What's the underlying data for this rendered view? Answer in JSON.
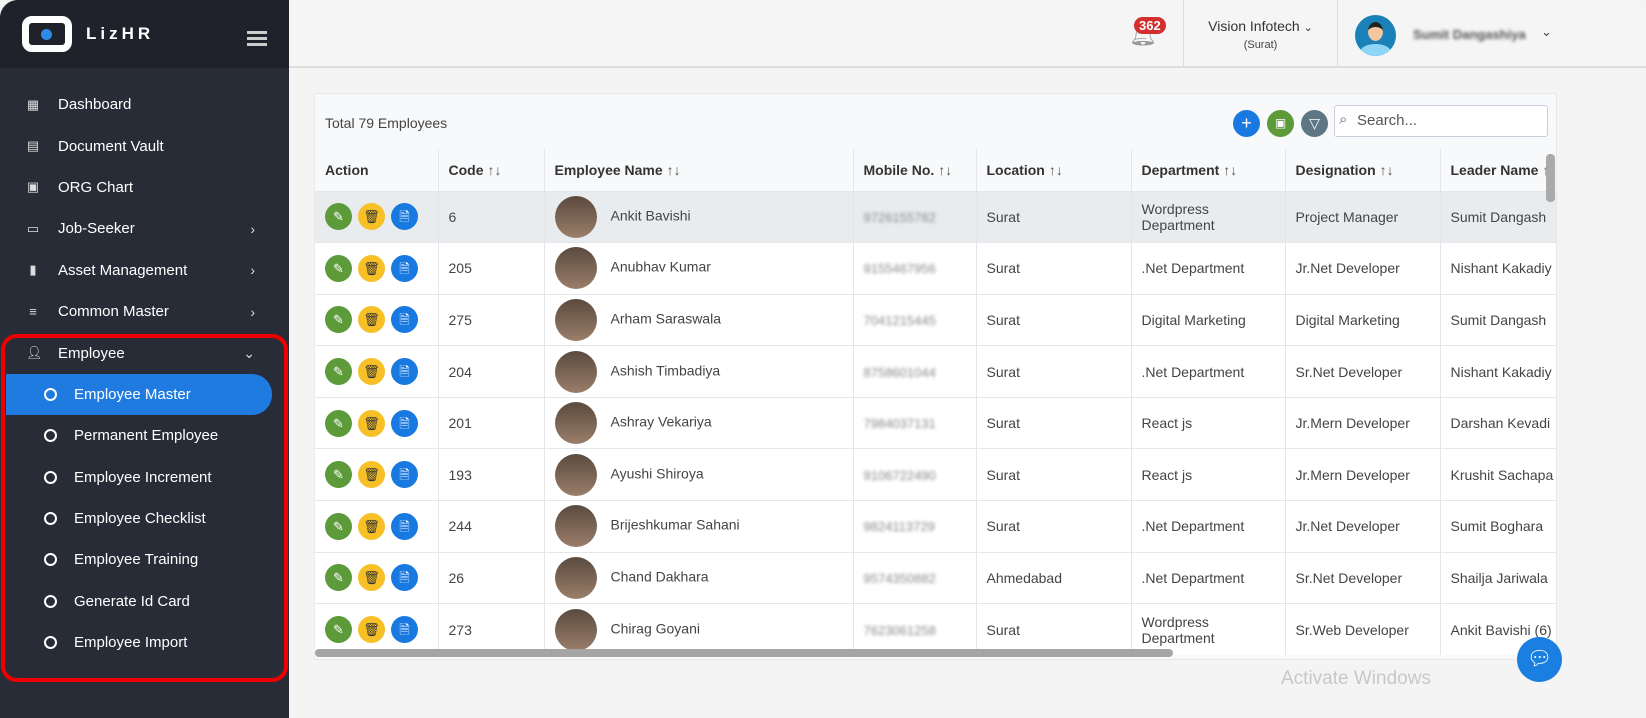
{
  "app": {
    "name": "LizHR"
  },
  "sidebar": {
    "items": [
      {
        "label": "Dashboard",
        "icon": "dashboard-icon"
      },
      {
        "label": "Document Vault",
        "icon": "document-icon"
      },
      {
        "label": "ORG Chart",
        "icon": "image-icon"
      },
      {
        "label": "Job-Seeker",
        "icon": "monitor-icon",
        "has_children": true
      },
      {
        "label": "Asset Management",
        "icon": "book-icon",
        "has_children": true
      },
      {
        "label": "Common Master",
        "icon": "list-icon",
        "has_children": true
      },
      {
        "label": "Employee",
        "icon": "user-icon",
        "expanded": true
      }
    ],
    "employee_sub": [
      {
        "label": "Employee Master",
        "active": true
      },
      {
        "label": "Permanent Employee"
      },
      {
        "label": "Employee Increment"
      },
      {
        "label": "Employee Checklist"
      },
      {
        "label": "Employee Training"
      },
      {
        "label": "Generate Id Card"
      },
      {
        "label": "Employee Import"
      }
    ]
  },
  "header": {
    "notification_count": "362",
    "company": "Vision Infotech",
    "branch": "(Surat)",
    "user": "Sumit Dangashiya"
  },
  "table": {
    "total": "Total 79 Employees",
    "search_placeholder": "Search...",
    "columns": [
      "Action",
      "Code",
      "Employee Name",
      "Mobile No.",
      "Location",
      "Department",
      "Designation",
      "Leader Name"
    ],
    "rows": [
      [
        "6",
        "Ankit Bavishi",
        "9726155782",
        "Surat",
        "Wordpress Department",
        "Project Manager",
        "Sumit Dangash"
      ],
      [
        "205",
        "Anubhav Kumar",
        "9155467956",
        "Surat",
        ".Net Department",
        "Jr.Net Developer",
        "Nishant Kakadiy"
      ],
      [
        "275",
        "Arham Saraswala",
        "7041215445",
        "Surat",
        "Digital Marketing",
        "Digital Marketing",
        "Sumit Dangash"
      ],
      [
        "204",
        "Ashish Timbadiya",
        "8758601044",
        "Surat",
        ".Net Department",
        "Sr.Net Developer",
        "Nishant Kakadiy"
      ],
      [
        "201",
        "Ashray Vekariya",
        "7984037131",
        "Surat",
        "React js",
        "Jr.Mern Developer",
        "Darshan Kevadi"
      ],
      [
        "193",
        "Ayushi Shiroya",
        "9106722490",
        "Surat",
        "React js",
        "Jr.Mern Developer",
        "Krushit Sachapa"
      ],
      [
        "244",
        "Brijeshkumar Sahani",
        "9824113729",
        "Surat",
        ".Net Department",
        "Jr.Net Developer",
        "Sumit Boghara"
      ],
      [
        "26",
        "Chand Dakhara",
        "9574350882",
        "Ahmedabad",
        ".Net Department",
        "Sr.Net Developer",
        "Shailja Jariwala"
      ],
      [
        "273",
        "Chirag Goyani",
        "7623061258",
        "Surat",
        "Wordpress Department",
        "Sr.Web Developer",
        "Ankit Bavishi (6)"
      ]
    ]
  },
  "watermark": "Activate Windows",
  "colors": {
    "sidebar": "#282c37",
    "active": "#1f7be0",
    "edit": "#5d9a3a",
    "delete": "#f6c026",
    "view": "#1879e0",
    "badge": "#d32f2f"
  }
}
